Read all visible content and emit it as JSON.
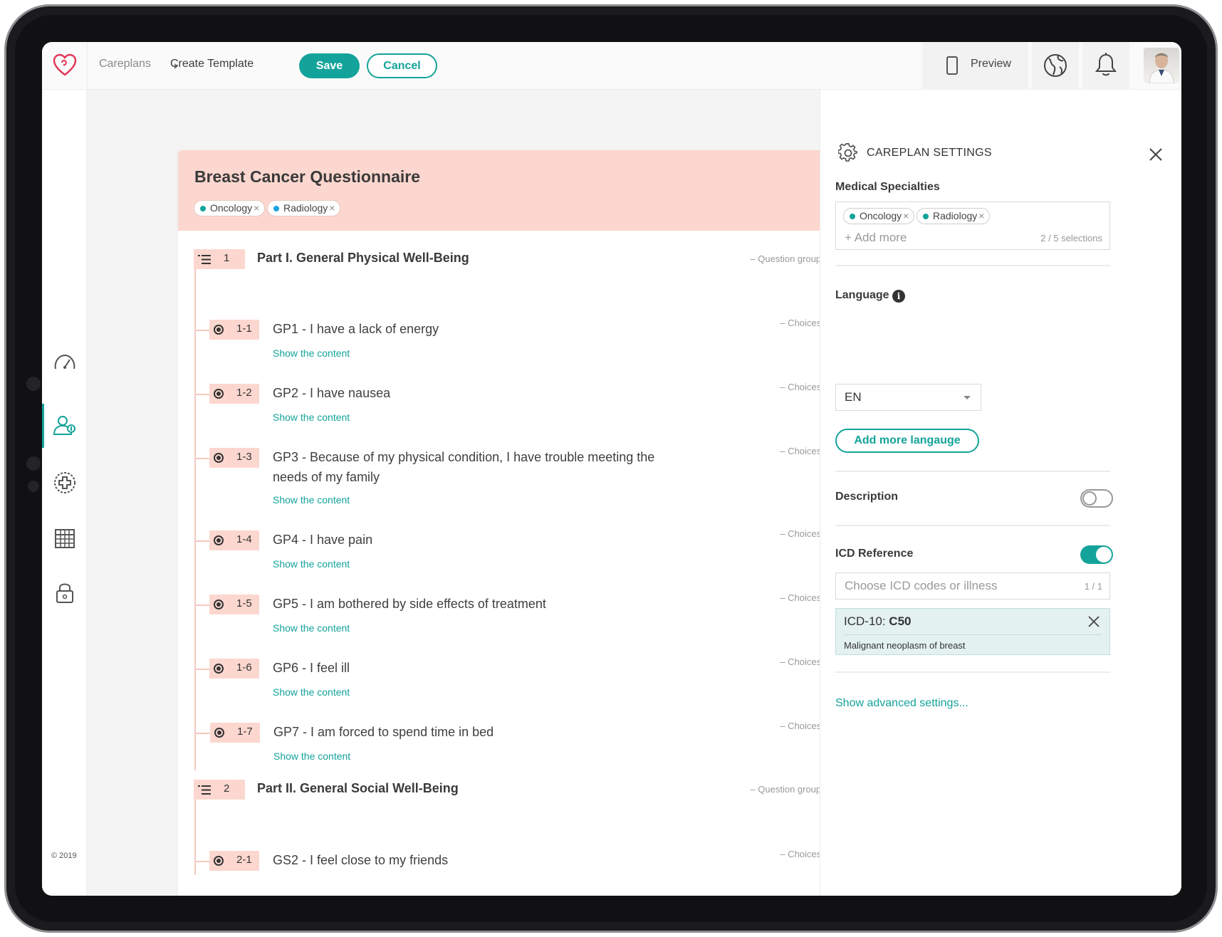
{
  "topbar": {
    "breadcrumb": [
      "Careplans",
      "Create Template"
    ],
    "save_label": "Save",
    "cancel_label": "Cancel",
    "preview_label": "Preview",
    "icons": [
      "heart-logo-icon",
      "phone-icon",
      "globe-icon",
      "bell-icon",
      "user-avatar"
    ]
  },
  "sidebar": {
    "items": [
      {
        "icon": "speedometer-icon"
      },
      {
        "icon": "patients-icon",
        "active": true
      },
      {
        "icon": "medical-plus-icon"
      },
      {
        "icon": "calendar-icon"
      },
      {
        "icon": "lock-icon"
      }
    ],
    "copyright": "© 2019"
  },
  "template": {
    "title": "Breast Cancer Questionnaire",
    "tags": [
      "Oncology",
      "Radiology"
    ],
    "groups": [
      {
        "number": "1",
        "title": "Part I. General Physical Well-Being",
        "meta": "– Question group –",
        "questions": [
          {
            "number": "1-1",
            "text": "GP1 - I have a lack of energy",
            "meta": "– Choices –",
            "link": "Show the content"
          },
          {
            "number": "1-2",
            "text": "GP2 - I have nausea",
            "meta": "– Choices –",
            "link": "Show the content"
          },
          {
            "number": "1-3",
            "text": "GP3 - Because of my physical condition, I have trouble meeting the needs of my family",
            "meta": "– Choices –",
            "link": "Show the content"
          },
          {
            "number": "1-4",
            "text": "GP4 - I have pain",
            "meta": "– Choices –",
            "link": "Show the content"
          },
          {
            "number": "1-5",
            "text": "GP5 - I am bothered by side effects of treatment",
            "meta": "– Choices –",
            "link": "Show the content"
          },
          {
            "number": "1-6",
            "text": "GP6 - I feel ill",
            "meta": "– Choices –",
            "link": "Show the content"
          },
          {
            "number": "1-7",
            "text": "GP7 - I am forced to spend time in bed",
            "meta": "– Choices –",
            "link": "Show the content"
          }
        ]
      },
      {
        "number": "2",
        "title": "Part II. General Social Well-Being",
        "meta": "– Question group –",
        "questions": [
          {
            "number": "2-1",
            "text": "GS2 - I feel close to my friends",
            "meta": "– Choices –"
          }
        ]
      }
    ]
  },
  "panel": {
    "title": "CAREPLAN SETTINGS",
    "specialties": {
      "label": "Medical Specialties",
      "tags": [
        "Oncology",
        "Radiology"
      ],
      "add_more": "+ Add more",
      "count": "2 / 5 selections"
    },
    "language": {
      "label": "Language",
      "value": "EN",
      "add_button": "Add more langauge"
    },
    "description": {
      "label": "Description",
      "enabled": false
    },
    "icd": {
      "label": "ICD Reference",
      "enabled": true,
      "placeholder": "Choose ICD codes or illness",
      "count": "1 / 1",
      "selected_prefix": "ICD-10: ",
      "selected_code": "C50",
      "selected_desc": "Malignant neoplasm of breast"
    },
    "advanced_link": "Show advanced settings..."
  },
  "colors": {
    "accent": "#14a39a",
    "header_pink": "#fcd7cf",
    "tag_blue_dot": "#1aa4e0"
  }
}
